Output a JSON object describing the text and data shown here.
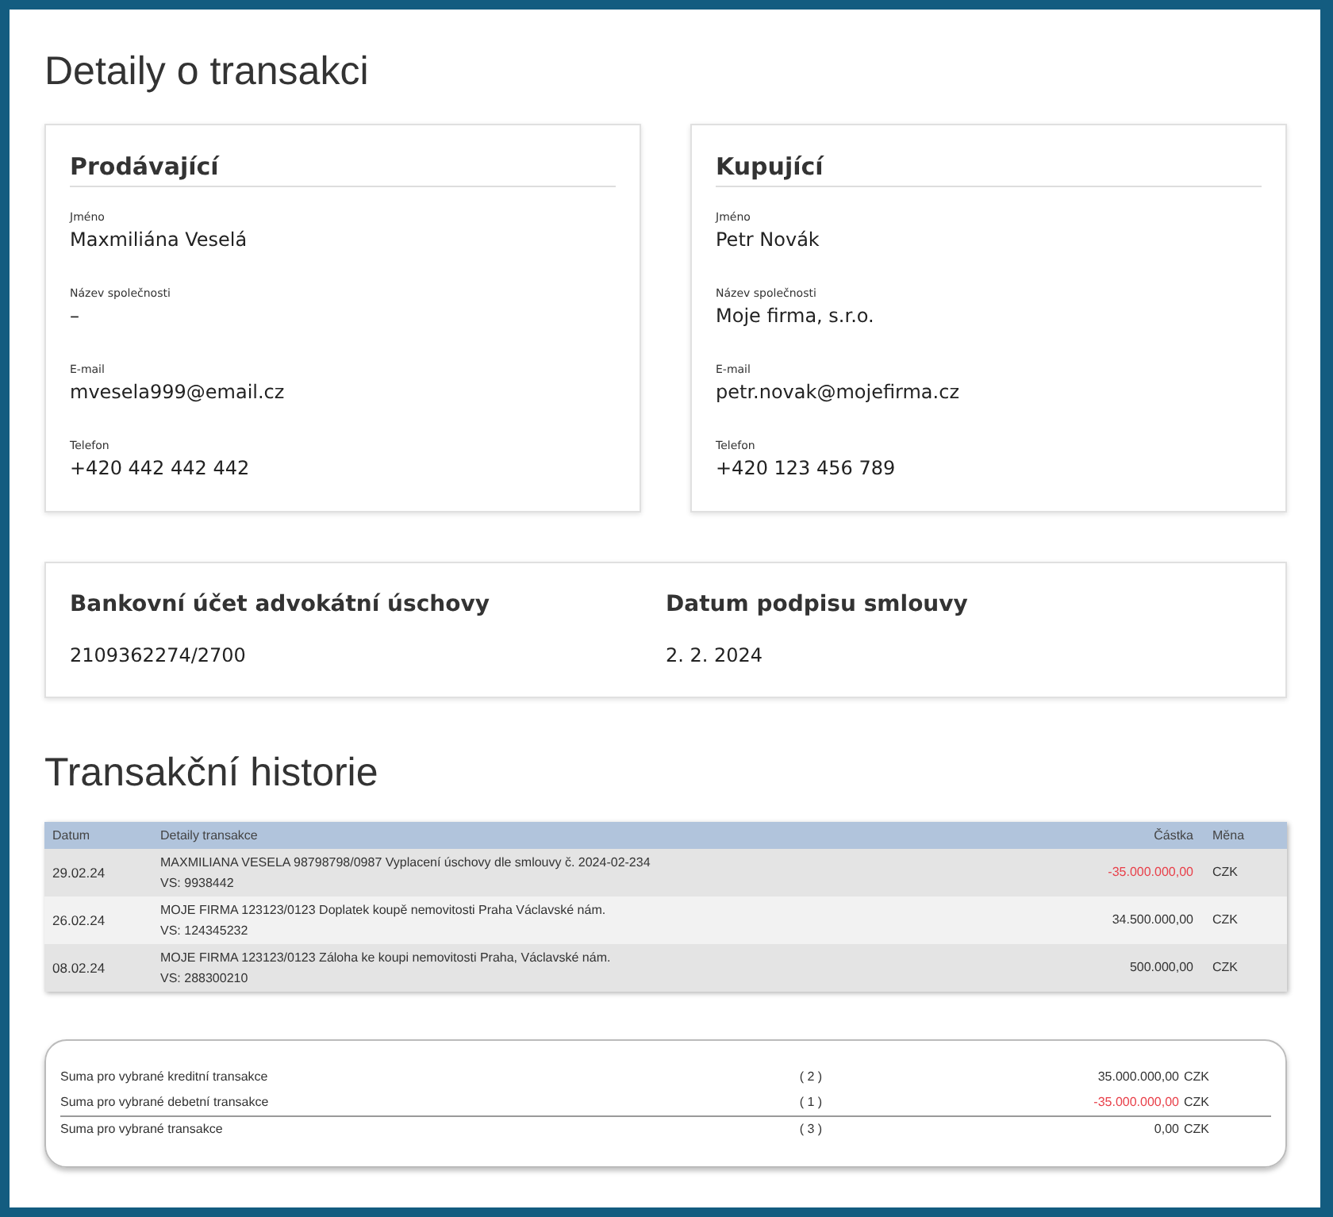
{
  "title": "Detaily o transakci",
  "parties": [
    {
      "heading": "Prodávající",
      "fields": [
        {
          "label": "Jméno",
          "value": "Maxmiliána Veselá"
        },
        {
          "label": "Název společnosti",
          "value": "–"
        },
        {
          "label": "E-mail",
          "value": "mvesela999@email.cz"
        },
        {
          "label": "Telefon",
          "value": "+420 442 442 442"
        }
      ]
    },
    {
      "heading": "Kupující",
      "fields": [
        {
          "label": "Jméno",
          "value": "Petr Novák"
        },
        {
          "label": "Název společnosti",
          "value": "Moje firma, s.r.o."
        },
        {
          "label": "E-mail",
          "value": "petr.novak@mojefirma.cz"
        },
        {
          "label": "Telefon",
          "value": "+420 123 456 789"
        }
      ]
    }
  ],
  "contract": [
    {
      "label": "Bankovní účet advokátní úschovy",
      "value": "2109362274/2700"
    },
    {
      "label": "Datum podpisu smlouvy",
      "value": "2. 2. 2024"
    }
  ],
  "history_title": "Transakční historie",
  "table": {
    "columns": [
      "Datum",
      "Detaily transakce",
      "Částka",
      "Měna"
    ],
    "rows": [
      {
        "date": "29.02.24",
        "details": "MAXMILIANA VESELA 98798798/0987 Vyplacení úschovy dle smlouvy č. 2024-02-234",
        "vs": "VS: 9938442",
        "amount": "-35.000.000,00",
        "negative": true,
        "currency": "CZK"
      },
      {
        "date": "26.02.24",
        "details": "MOJE FIRMA 123123/0123 Doplatek koupě nemovitosti Praha Václavské nám.",
        "vs": "VS: 124345232",
        "amount": "34.500.000,00",
        "negative": false,
        "currency": "CZK"
      },
      {
        "date": "08.02.24",
        "details": "MOJE FIRMA 123123/0123 Záloha ke koupi nemovitosti Praha, Václavské nám.",
        "vs": "VS: 288300210",
        "amount": "500.000,00",
        "negative": false,
        "currency": "CZK"
      }
    ]
  },
  "summary": [
    {
      "label": "Suma pro vybrané kreditní transakce",
      "count": "( 2 )",
      "amount": "35.000.000,00",
      "negative": false,
      "currency": "CZK"
    },
    {
      "label": "Suma pro vybrané debetní transakce",
      "count": "( 1 )",
      "amount": "-35.000.000,00",
      "negative": true,
      "currency": "CZK"
    },
    {
      "label": "Suma pro vybrané transakce",
      "count": "( 3 )",
      "amount": "0,00",
      "negative": false,
      "currency": "CZK"
    }
  ]
}
